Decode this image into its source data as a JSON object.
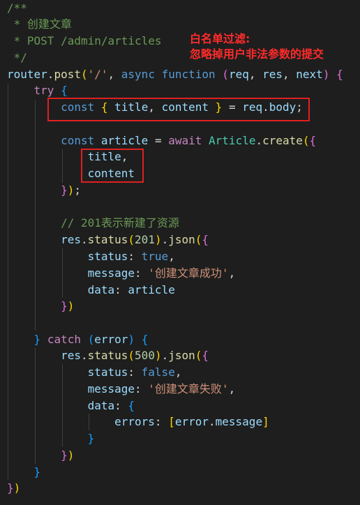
{
  "annotation": {
    "line1": "白名单过滤:",
    "line2": "忽略掉用户非法参数的提交"
  },
  "code": {
    "c1": "/**",
    "c2": " * 创建文章",
    "c3": " * POST /admin/articles",
    "c4": " */",
    "router": "router",
    "post": "post",
    "route_str": "'/'",
    "async": "async",
    "function": "function",
    "req": "req",
    "res": "res",
    "next": "next",
    "try": "try",
    "const": "const",
    "title": "title",
    "content": "content",
    "body": "body",
    "article": "article",
    "await": "await",
    "Article": "Article",
    "create": "create",
    "comment201": "// 201表示新建了资源",
    "status": "status",
    "json": "json",
    "n201": "201",
    "true": "true",
    "message": "message",
    "msg_ok": "'创建文章成功'",
    "data": "data",
    "catch": "catch",
    "error": "error",
    "n500": "500",
    "false": "false",
    "msg_fail": "'创建文章失败'",
    "errors": "errors"
  },
  "colors": {
    "background": "#1e1e1e",
    "highlight_box": "#e02020",
    "annotation_text": "#ff2b2b"
  }
}
